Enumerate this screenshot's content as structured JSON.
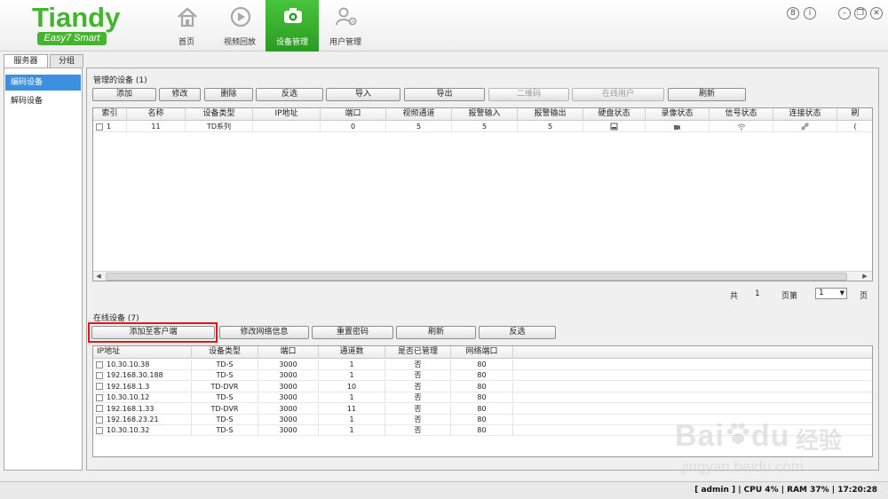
{
  "brand": {
    "name": "Tiandy",
    "tagline": "Easy7 Smart"
  },
  "nav": [
    {
      "label": "首页",
      "icon": "home-icon"
    },
    {
      "label": "视频回放",
      "icon": "playback-icon"
    },
    {
      "label": "设备管理",
      "icon": "camera-icon",
      "active": true
    },
    {
      "label": "用户管理",
      "icon": "users-gear-icon"
    }
  ],
  "window_controls": {
    "lock": "8",
    "info": "i",
    "minimize": "–",
    "restore": "❐",
    "close": "✕"
  },
  "side_tabs": [
    "服务器",
    "分组"
  ],
  "sidebar_items": [
    {
      "label": "编码设备",
      "selected": true
    },
    {
      "label": "解码设备"
    }
  ],
  "managed": {
    "title": "管理的设备 (1)",
    "toolbar": [
      {
        "label": "添加"
      },
      {
        "label": "修改"
      },
      {
        "label": "删除"
      },
      {
        "label": "反选"
      },
      {
        "label": "导入"
      },
      {
        "label": "导出"
      },
      {
        "label": "二维码",
        "disabled": true
      },
      {
        "label": "在线用户",
        "disabled": true
      },
      {
        "label": "刷新"
      }
    ],
    "columns": [
      "索引",
      "名称",
      "设备类型",
      "IP地址",
      "端口",
      "视频通道",
      "报警输入",
      "报警输出",
      "硬盘状态",
      "录像状态",
      "信号状态",
      "连接状态",
      "刷"
    ],
    "rows": [
      {
        "index": "1",
        "name": "11",
        "type": "TD系列",
        "ip": "",
        "port": "0",
        "video": "5",
        "alarm_in": "5",
        "alarm_out": "5",
        "disk_icon": "disk-icon",
        "record_icon": "record-icon",
        "signal_icon": "wifi-icon",
        "conn_icon": "link-icon",
        "extra": "("
      }
    ],
    "pager": {
      "total_label": "共",
      "total": "1",
      "page_label": "页第",
      "page_value": "1",
      "page_suffix": "页"
    }
  },
  "online": {
    "title": "在线设备 (7)",
    "toolbar": [
      {
        "label": "添加至客户端",
        "highlighted": true
      },
      {
        "label": "修改网络信息"
      },
      {
        "label": "重置密码"
      },
      {
        "label": "刷新"
      },
      {
        "label": "反选"
      }
    ],
    "columns": [
      "IP地址",
      "设备类型",
      "端口",
      "通道数",
      "是否已管理",
      "网络端口"
    ],
    "rows": [
      {
        "ip": "10.30.10.38",
        "type": "TD-S",
        "port": "3000",
        "channels": "1",
        "managed": "否",
        "net_port": "80"
      },
      {
        "ip": "192.168.30.188",
        "type": "TD-S",
        "port": "3000",
        "channels": "1",
        "managed": "否",
        "net_port": "80"
      },
      {
        "ip": "192.168.1.3",
        "type": "TD-DVR",
        "port": "3000",
        "channels": "10",
        "managed": "否",
        "net_port": "80"
      },
      {
        "ip": "10.30.10.12",
        "type": "TD-S",
        "port": "3000",
        "channels": "1",
        "managed": "否",
        "net_port": "80"
      },
      {
        "ip": "192.168.1.33",
        "type": "TD-DVR",
        "port": "3000",
        "channels": "11",
        "managed": "否",
        "net_port": "80"
      },
      {
        "ip": "192.168.23.21",
        "type": "TD-S",
        "port": "3000",
        "channels": "1",
        "managed": "否",
        "net_port": "80"
      },
      {
        "ip": "10.30.10.32",
        "type": "TD-S",
        "port": "3000",
        "channels": "1",
        "managed": "否",
        "net_port": "80"
      }
    ]
  },
  "status": {
    "text": "[ admin ] | CPU   4% | RAM  37% | 17:20:28"
  },
  "watermark": {
    "word": "Bai",
    "word2": "du",
    "cn": "经验",
    "url": "jingyan.baidu.com"
  },
  "colors": {
    "brand_green": "#45b52f",
    "nav_active": "#2b9b22",
    "selection_blue": "#3d8fe0",
    "highlight_red": "#e01818"
  }
}
